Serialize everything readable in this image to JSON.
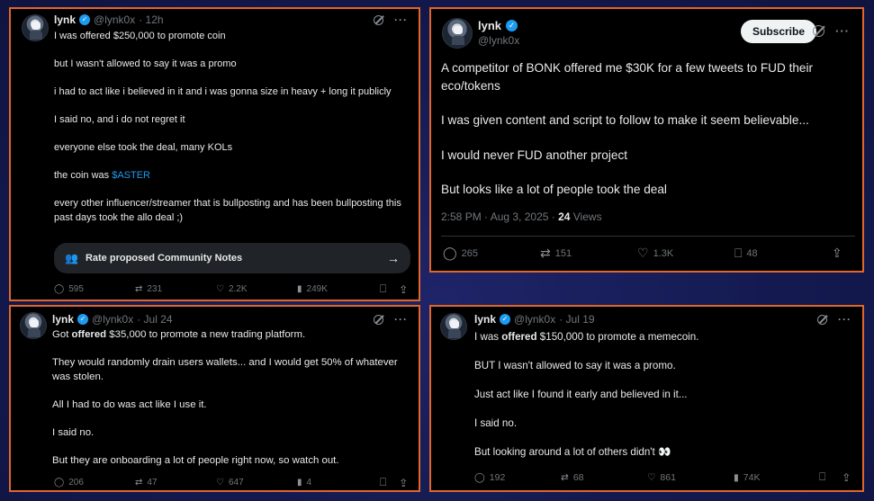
{
  "posts": [
    {
      "name": "lynk",
      "handle": "@lynk0x",
      "time": "· 12h",
      "paragraphs": [
        "I was offered $250,000 to promote coin",
        "but I wasn't allowed to say it was a promo",
        "i had to act like i believed in it and i was gonna size in heavy + long it publicly",
        "I said no, and i do not regret it",
        "everyone else took the deal, many KOLs",
        "every other influencer/streamer that is bullposting and has been bullposting this past days took the allo deal ;)"
      ],
      "coin_prefix": "the coin was ",
      "coin_ticker": "$ASTER",
      "community_notes_label": "Rate proposed Community Notes",
      "stats": {
        "replies": "595",
        "reposts": "231",
        "likes": "2.2K",
        "views": "249K"
      }
    },
    {
      "name": "lynk",
      "handle": "@lynk0x",
      "subscribe_label": "Subscribe",
      "paragraphs": [
        "A competitor of BONK offered me $30K for a few tweets to FUD their eco/tokens",
        "I was given content and script to follow to make it seem believable...",
        "I would never FUD another project",
        "But looks like a lot of people took the deal"
      ],
      "timestamp": "2:58 PM · Aug 3, 2025 · ",
      "views_count": "24",
      "views_label": " Views",
      "stats": {
        "replies": "265",
        "reposts": "151",
        "likes": "1.3K",
        "bookmarks": "48"
      }
    },
    {
      "name": "lynk",
      "handle": "@lynk0x",
      "time": "· Jul 24",
      "first_pre": "Got ",
      "first_bold": "offered",
      "first_post": " $35,000 to promote a new trading platform.",
      "paragraphs": [
        "They would randomly drain users wallets... and I would get 50% of whatever was stolen.",
        "All I had to do was act like I use it.",
        "I said no.",
        "But they are onboarding a lot of people right now, so watch out."
      ],
      "stats": {
        "replies": "206",
        "reposts": "47",
        "likes": "647",
        "views": "4"
      }
    },
    {
      "name": "lynk",
      "handle": "@lynk0x",
      "time": "· Jul 19",
      "first_pre": "I was ",
      "first_bold": "offered",
      "first_post": " $150,000 to promote a memecoin.",
      "paragraphs": [
        "BUT I wasn't allowed to say it was a promo.",
        "Just act like I found it early and believed in it...",
        "I said no.",
        "But looking around a lot of others didn't 👀"
      ],
      "stats": {
        "replies": "192",
        "reposts": "68",
        "likes": "861",
        "views": "74K"
      }
    }
  ],
  "colors": {
    "card_border": "#e0662a",
    "verified": "#1d9bf0",
    "link": "#1d9bf0",
    "muted": "#71767b"
  },
  "icons": [
    "verified-badge-icon",
    "grok-icon",
    "more-icon",
    "reply-icon",
    "repost-icon",
    "like-icon",
    "views-icon",
    "bookmark-icon",
    "share-icon",
    "community-notes-icon",
    "arrow-right-icon"
  ]
}
